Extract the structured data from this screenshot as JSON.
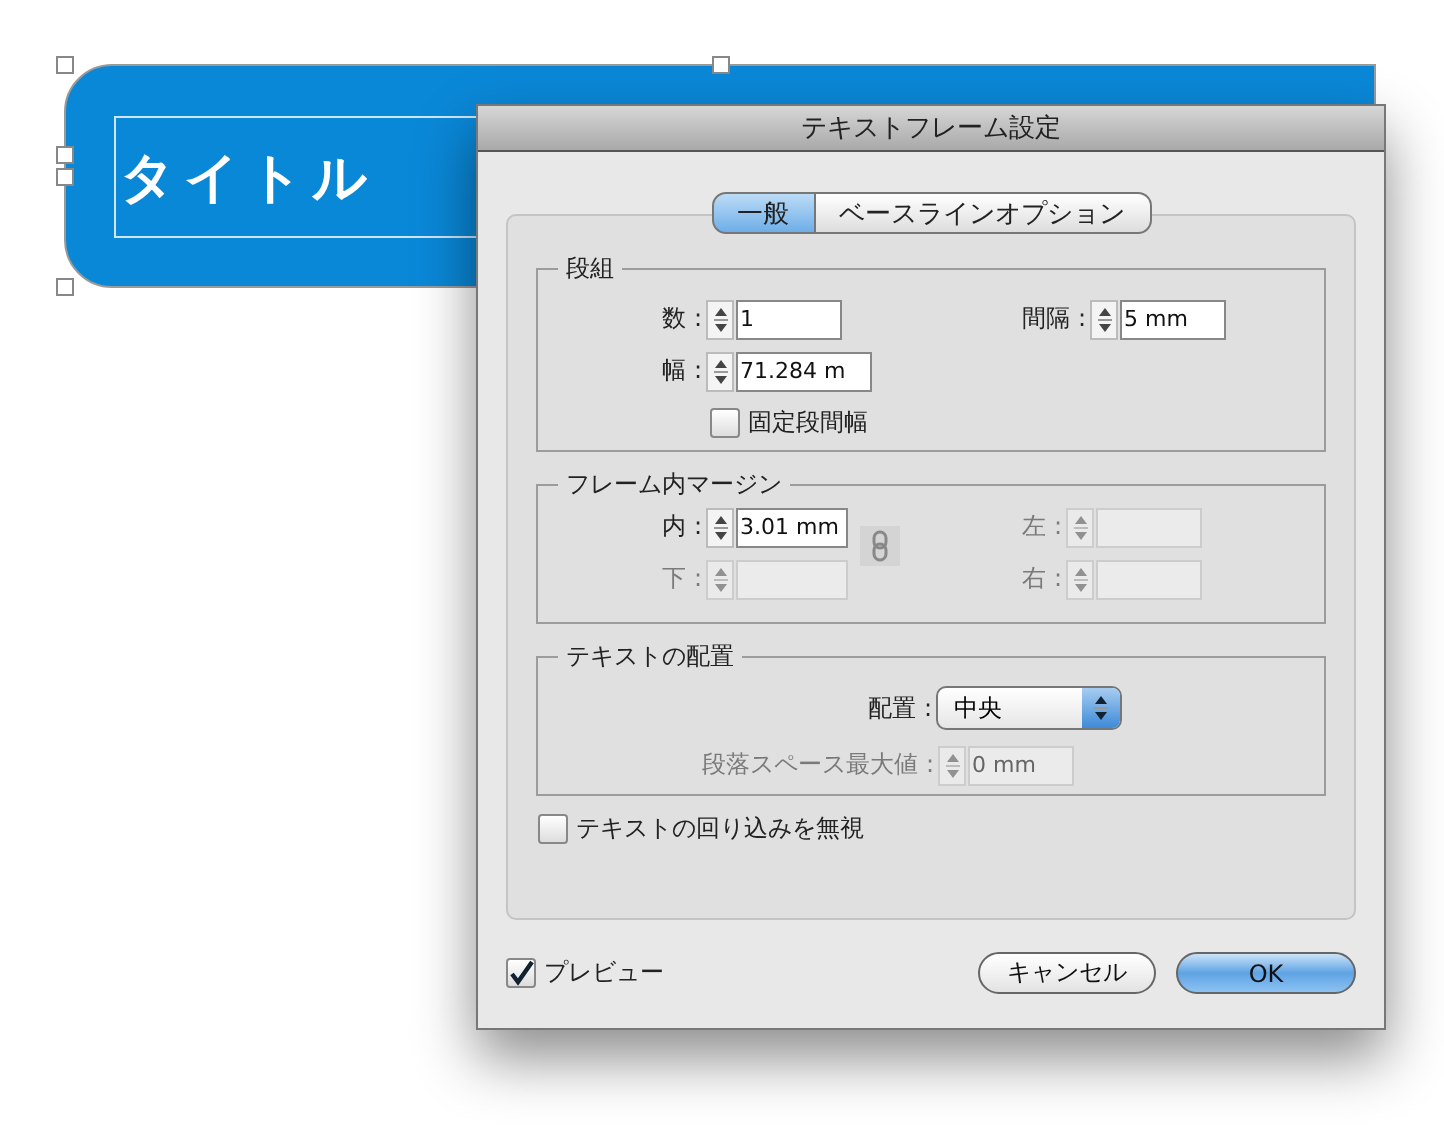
{
  "canvas": {
    "frame_text": "タイトル"
  },
  "dialog": {
    "title": "テキストフレーム設定",
    "tabs": [
      {
        "label": "一般",
        "selected": true
      },
      {
        "label": "ベースラインオプション",
        "selected": false
      }
    ],
    "columns": {
      "title": "段組",
      "number": {
        "label": "数 :",
        "value": "1",
        "disabled": false
      },
      "gutter": {
        "label": "間隔 :",
        "value": "5 mm",
        "disabled": false
      },
      "width": {
        "label": "幅 :",
        "value": "71.284 m",
        "disabled": false
      },
      "fixed_width": {
        "label": "固定段間幅",
        "checked": false
      }
    },
    "insets": {
      "title": "フレーム内マージン",
      "top": {
        "label": "内 :",
        "value": "3.01 mm",
        "disabled": false
      },
      "left": {
        "label": "左 :",
        "disabled": true
      },
      "bottom": {
        "label": "下 :",
        "disabled": true
      },
      "right": {
        "label": "右 :",
        "disabled": true
      },
      "link": {
        "on": false
      }
    },
    "placement": {
      "title": "テキストの配置",
      "align": {
        "label": "配置 :",
        "value": "中央"
      },
      "max_spacing": {
        "label": "段落スペース最大値 :",
        "value": "0 mm",
        "disabled": true
      }
    },
    "ignore_wrap": {
      "label": "テキストの回り込みを無視",
      "checked": false
    },
    "preview": {
      "label": "プレビュー",
      "checked": true
    },
    "buttons": [
      {
        "label": "キャンセル",
        "default": false
      },
      {
        "label": "OK",
        "default": true
      }
    ]
  }
}
